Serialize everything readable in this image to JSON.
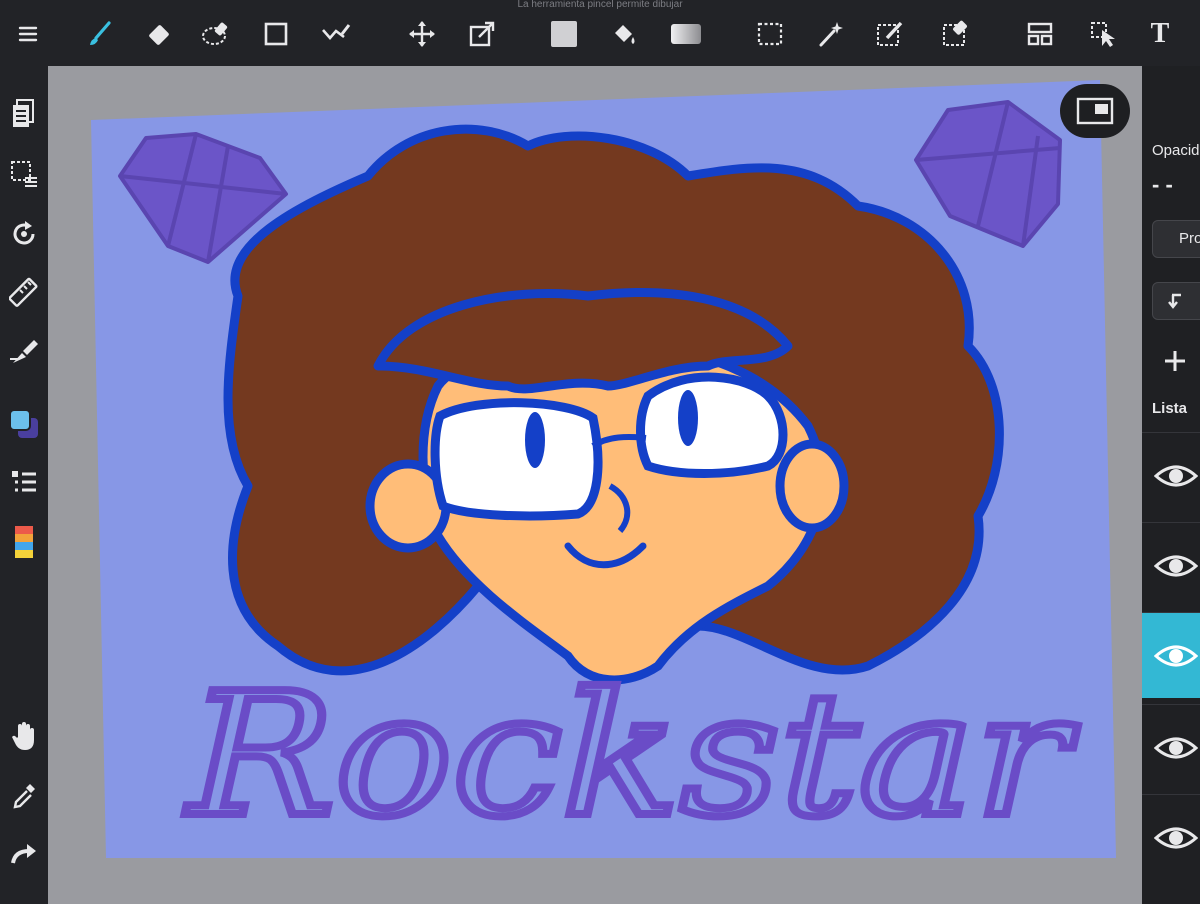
{
  "window_title": "La herramienta pincel permite dibujar",
  "toolbar": {
    "tools": [
      {
        "name": "menu",
        "icon": "menu-icon"
      },
      {
        "name": "brush",
        "icon": "brush-icon",
        "active": true
      },
      {
        "name": "eraser",
        "icon": "eraser-icon"
      },
      {
        "name": "lasso-fill",
        "icon": "lasso-fill-icon"
      },
      {
        "name": "shape",
        "icon": "rectangle-icon"
      },
      {
        "name": "correction",
        "icon": "correction-icon"
      },
      {
        "name": "move",
        "icon": "move-icon"
      },
      {
        "name": "transform",
        "icon": "transform-icon"
      },
      {
        "name": "fill-color",
        "icon": "fill-color-icon"
      },
      {
        "name": "bucket",
        "icon": "bucket-icon"
      },
      {
        "name": "gradient",
        "icon": "gradient-icon"
      },
      {
        "name": "select",
        "icon": "select-icon"
      },
      {
        "name": "magic-wand",
        "icon": "magic-wand-icon"
      },
      {
        "name": "select-pen",
        "icon": "select-pen-icon"
      },
      {
        "name": "select-eraser",
        "icon": "select-eraser-icon"
      },
      {
        "name": "frame-divider",
        "icon": "frame-divider-icon"
      },
      {
        "name": "operation",
        "icon": "operation-icon"
      },
      {
        "name": "text",
        "icon": "text-icon",
        "label": "T"
      }
    ]
  },
  "sidebar": {
    "items": [
      {
        "name": "pages",
        "icon": "pages-icon"
      },
      {
        "name": "selection",
        "icon": "selection-icon"
      },
      {
        "name": "rotate",
        "icon": "rotate-icon"
      },
      {
        "name": "ruler",
        "icon": "ruler-icon"
      },
      {
        "name": "snap",
        "icon": "snap-pen-icon"
      },
      {
        "name": "color",
        "icon": "color-swatch-icon"
      },
      {
        "name": "layers",
        "icon": "layers-list-icon"
      },
      {
        "name": "palette",
        "icon": "palette-icon"
      },
      {
        "name": "hand",
        "icon": "hand-icon"
      },
      {
        "name": "eyedropper",
        "icon": "eyedropper-icon"
      },
      {
        "name": "redo",
        "icon": "redo-icon"
      }
    ]
  },
  "right_panel": {
    "opacity_label": "Opacidad",
    "opacity_controls": "- -",
    "blend_label": "Pro",
    "list_label": "Lista",
    "layers": [
      {
        "visible": true,
        "active": false
      },
      {
        "visible": true,
        "active": false
      },
      {
        "visible": true,
        "active": true
      },
      {
        "visible": true,
        "active": false
      },
      {
        "visible": true,
        "active": false
      }
    ],
    "accent_color": "#33b8d4"
  },
  "artwork": {
    "lettering": "Rockstar",
    "colors": {
      "background": "#8797e6",
      "hair": "#74391f",
      "skin": "#ffbd78",
      "outline": "#1440c8",
      "gem": "#6b55c8",
      "lettering": "#6a4cc7"
    }
  }
}
